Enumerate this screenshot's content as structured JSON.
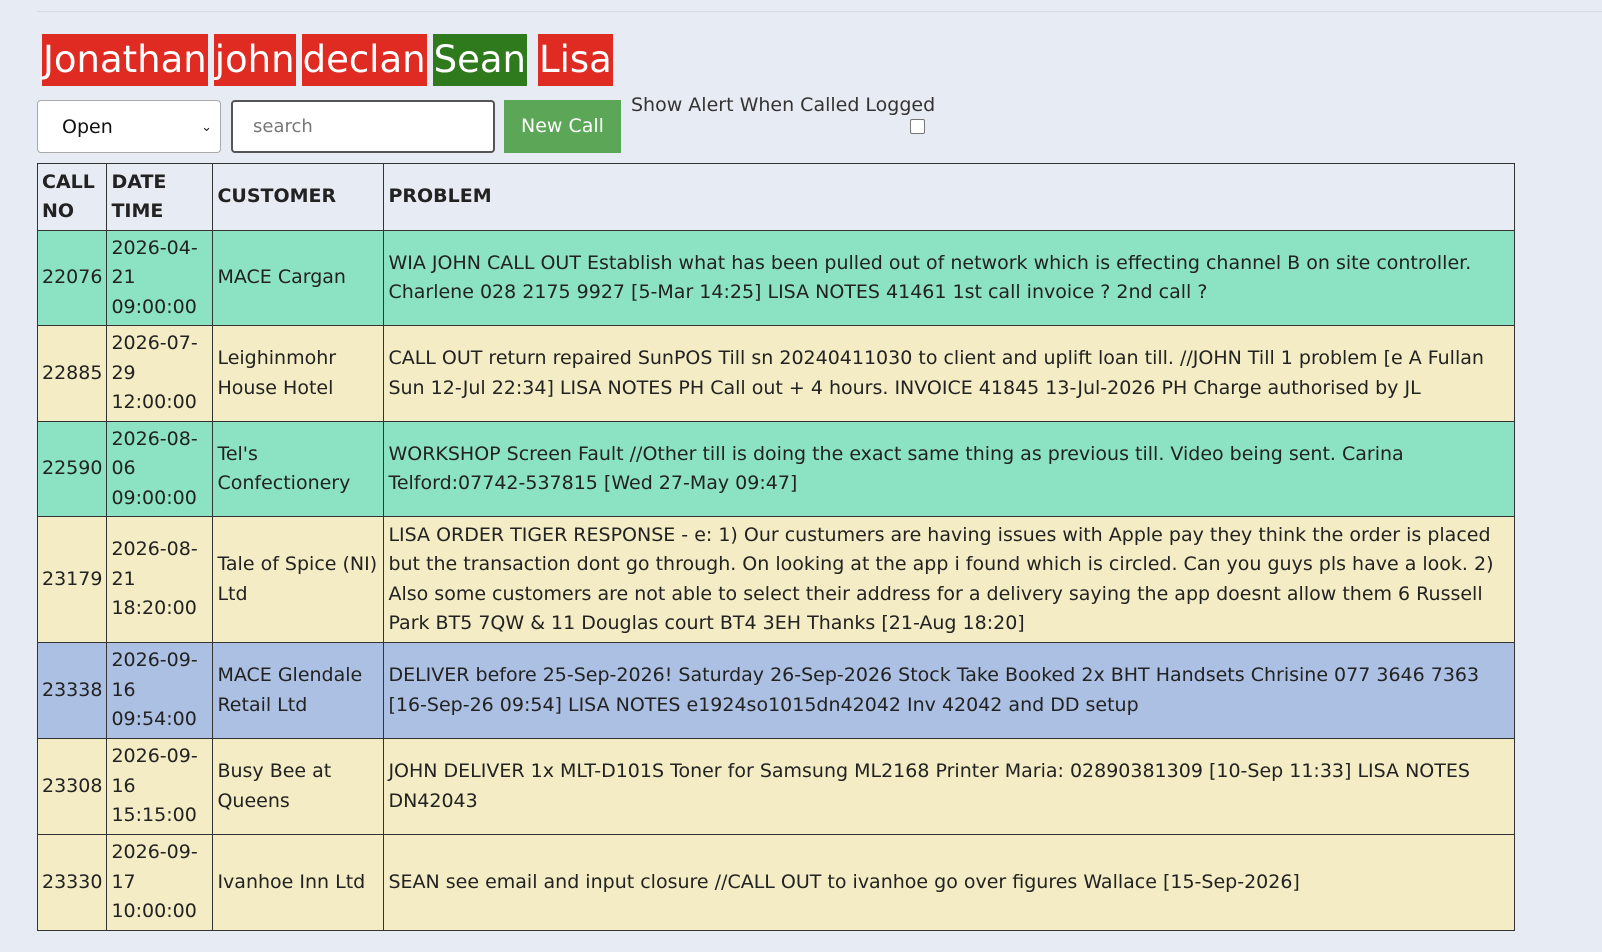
{
  "users": [
    {
      "name": "Jonathan",
      "color": "#e02b23"
    },
    {
      "name": "john",
      "color": "#e02b23"
    },
    {
      "name": "declan",
      "color": "#e02b23"
    },
    {
      "name": "Sean",
      "color": "#2f7a1d"
    },
    {
      "name": "Lisa",
      "color": "#e02b23"
    }
  ],
  "controls": {
    "status_value": "Open",
    "search_placeholder": "search",
    "new_call_label": "New Call",
    "alert_label": "Show Alert When Called Logged",
    "alert_checked": false
  },
  "table": {
    "headers": {
      "call_no": "CALL NO",
      "date_time": "DATE TIME",
      "customer": "CUSTOMER",
      "problem": "PROBLEM"
    },
    "rows": [
      {
        "call_no": "22076",
        "date": "2026-04-21",
        "time": "09:00:00",
        "customer": "MACE Cargan",
        "problem": "WIA JOHN CALL OUT Establish what has been pulled out of network which is effecting channel B on site controller. Charlene 028 2175 9927 [5-Mar 14:25] LISA NOTES 41461 1st call invoice ? 2nd call ?",
        "status_color": "green"
      },
      {
        "call_no": "22885",
        "date": "2026-07-29",
        "time": "12:00:00",
        "customer": "Leighinmohr House Hotel",
        "problem": "CALL OUT return repaired SunPOS Till sn 20240411030 to client and uplift loan till. //JOHN Till 1 problem [e A Fullan Sun 12-Jul 22:34] LISA NOTES PH Call out + 4 hours. INVOICE 41845 13-Jul-2026 PH Charge authorised by JL",
        "status_color": "cream"
      },
      {
        "call_no": "22590",
        "date": "2026-08-06",
        "time": "09:00:00",
        "customer": "Tel's Confectionery",
        "problem": "WORKSHOP Screen Fault //Other till is doing the exact same thing as previous till. Video being sent. Carina Telford:07742-537815 [Wed 27-May 09:47]",
        "status_color": "green"
      },
      {
        "call_no": "23179",
        "date": "2026-08-21",
        "time": "18:20:00",
        "customer": "Tale of Spice (NI) Ltd",
        "problem": "LISA ORDER TIGER RESPONSE - e: 1) Our custumers are having issues with Apple pay they think the order is placed but the transaction dont go through. On looking at the app i found which is circled. Can you guys pls have a look. 2) Also some customers are not able to select their address for a delivery saying the app doesnt allow them 6 Russell Park BT5 7QW & 11 Douglas court BT4 3EH Thanks [21-Aug 18:20]",
        "status_color": "cream"
      },
      {
        "call_no": "23338",
        "date": "2026-09-16",
        "time": "09:54:00",
        "customer": "MACE Glendale Retail Ltd",
        "problem": "DELIVER before 25-Sep-2026! Saturday 26-Sep-2026 Stock Take Booked 2x BHT Handsets Chrisine 077 3646 7363 [16-Sep-26 09:54] LISA NOTES e1924so1015dn42042 Inv 42042 and DD setup",
        "status_color": "blue"
      },
      {
        "call_no": "23308",
        "date": "2026-09-16",
        "time": "15:15:00",
        "customer": "Busy Bee at Queens",
        "problem": "JOHN DELIVER 1x MLT-D101S Toner for Samsung ML2168 Printer Maria: 02890381309 [10-Sep 11:33] LISA NOTES DN42043",
        "status_color": "cream"
      },
      {
        "call_no": "23330",
        "date": "2026-09-17",
        "time": "10:00:00",
        "customer": "Ivanhoe Inn Ltd",
        "problem": "SEAN see email and input closure //CALL OUT to ivanhoe go over figures Wallace [15-Sep-2026]",
        "status_color": "cream"
      }
    ]
  }
}
